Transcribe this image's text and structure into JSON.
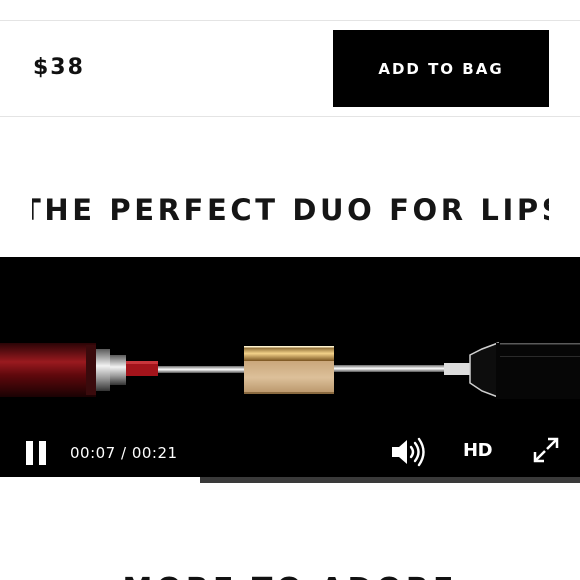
{
  "purchase": {
    "price": "$38",
    "add_to_bag_label": "ADD TO BAG"
  },
  "section": {
    "headline": "THE PERFECT DUO FOR LIPS"
  },
  "video": {
    "time_display": "00:07 / 00:21",
    "hd_label": "HD",
    "progress_fraction": 0.3448,
    "controls": {
      "play_pause": "pause-icon",
      "volume": "speaker-volume-icon",
      "fullscreen": "expand-icon"
    }
  },
  "next_section": {
    "heading": "MORE TO ADORE"
  },
  "colors": {
    "button_bg": "#000000",
    "video_bg": "#000000",
    "lipstick_red": "#8c0f16",
    "gold_cap": "#c9a063"
  }
}
